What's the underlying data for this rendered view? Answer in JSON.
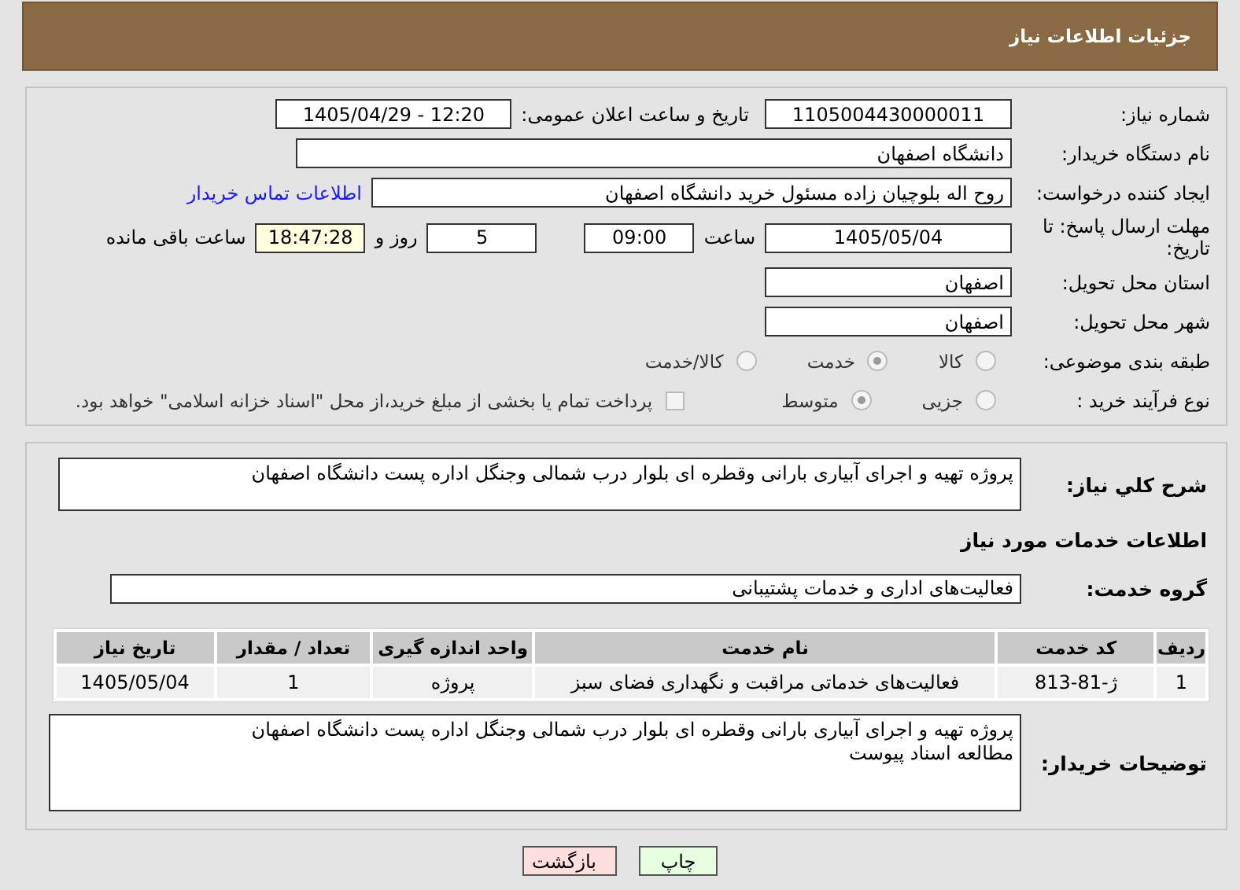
{
  "header": {
    "title": "جزئیات اطلاعات نیاز"
  },
  "need_number": {
    "label": "شماره نیاز:",
    "value": "1105004430000011"
  },
  "announce": {
    "label": "تاریخ و ساعت اعلان عمومی:",
    "value": "1405/04/29 - 12:20"
  },
  "buyer": {
    "label": "نام دستگاه خریدار:",
    "value": "دانشگاه اصفهان"
  },
  "requester": {
    "label": "ایجاد کننده درخواست:",
    "value": "روح اله بلوچیان زاده مسئول خرید دانشگاه اصفهان",
    "link": "اطلاعات تماس خریدار"
  },
  "deadline": {
    "label": "مهلت ارسال پاسخ: تا تاریخ:",
    "date": "1405/05/04",
    "time_label": "ساعت",
    "time": "09:00",
    "days": "5",
    "days_label": "روز و",
    "remaining": "18:47:28",
    "remaining_label": "ساعت باقی مانده"
  },
  "province": {
    "label": "استان محل تحویل:",
    "value": "اصفهان"
  },
  "city": {
    "label": "شهر محل تحویل:",
    "value": "اصفهان"
  },
  "category": {
    "label": "طبقه بندی موضوعی:",
    "options": [
      {
        "label": "کالا",
        "selected": false
      },
      {
        "label": "خدمت",
        "selected": true
      },
      {
        "label": "کالا/خدمت",
        "selected": false
      }
    ]
  },
  "process": {
    "label": "نوع فرآیند خرید :",
    "options": [
      {
        "label": "جزیی",
        "selected": false
      },
      {
        "label": "متوسط",
        "selected": true
      }
    ],
    "payment": {
      "checked": false,
      "text": "پرداخت تمام یا بخشی از مبلغ خرید،از محل \"اسناد خزانه اسلامی\" خواهد بود."
    }
  },
  "description": {
    "label": "شرح کلي نياز:",
    "value": "پروژه تهیه و اجرای آبیاری بارانی وقطره ای بلوار درب شمالی وجنگل اداره پست دانشگاه اصفهان"
  },
  "services_title": "اطلاعات خدمات مورد نیاز",
  "service_group": {
    "label": "گروه خدمت:",
    "value": "فعالیت‌های اداری و خدمات پشتیبانی"
  },
  "table": {
    "columns": [
      "ردیف",
      "کد خدمت",
      "نام خدمت",
      "واحد اندازه گیری",
      "تعداد / مقدار",
      "تاریخ نیاز"
    ],
    "rows": [
      [
        "1",
        "ژ-81-813",
        "فعالیت‌های خدماتی مراقبت و نگهداری فضای سبز",
        "پروژه",
        "1",
        "1405/05/04"
      ]
    ]
  },
  "buyer_notes": {
    "label": "توضیحات خریدار:",
    "lines": [
      "پروژه تهیه و اجرای آبیاری بارانی وقطره ای بلوار درب شمالی وجنگل اداره پست دانشگاه اصفهان",
      "مطالعه اسناد پیوست"
    ]
  },
  "buttons": [
    {
      "label": "چاپ",
      "kind": "print"
    },
    {
      "label": "بازگشت",
      "kind": "back"
    }
  ]
}
